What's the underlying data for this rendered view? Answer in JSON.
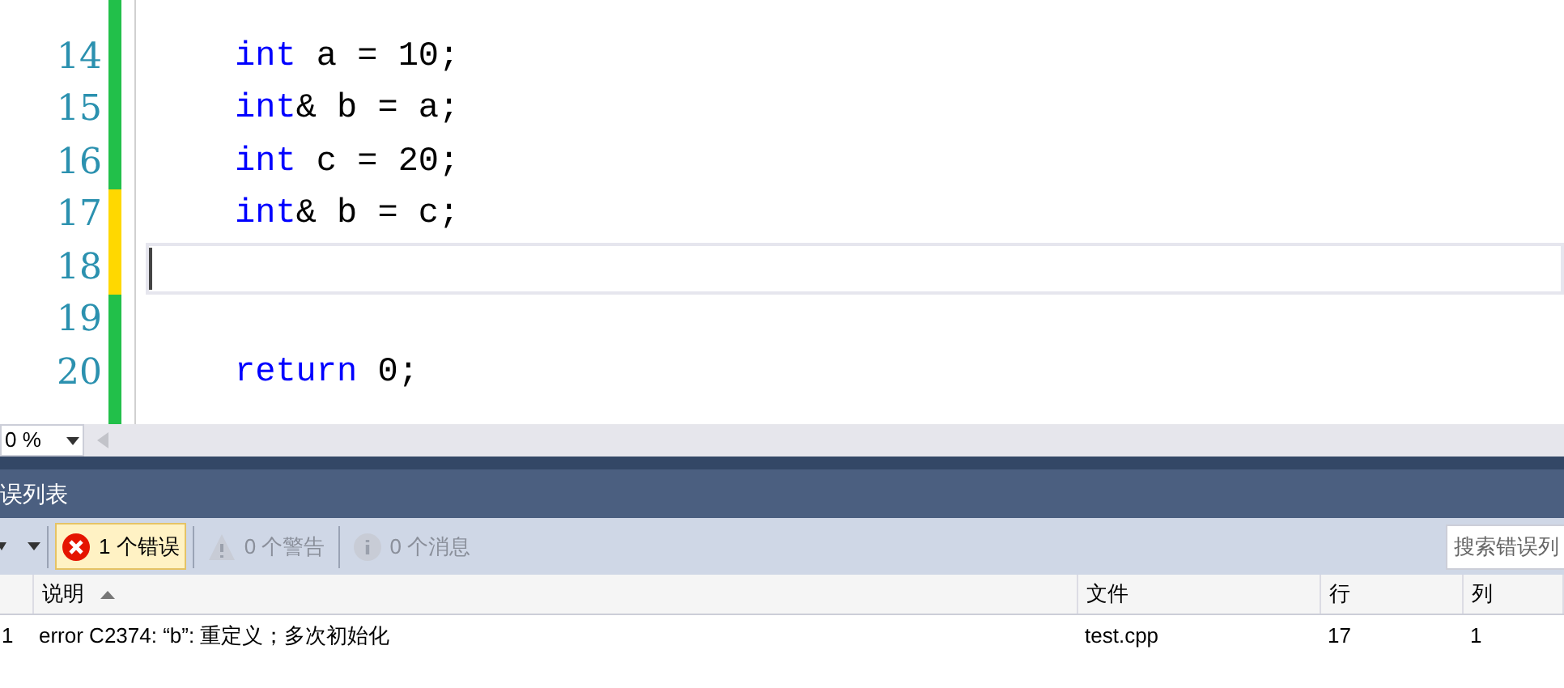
{
  "editor": {
    "lines": [
      {
        "color": "#22c04a"
      },
      {
        "number": "14",
        "color": "#22c04a",
        "tokens": [
          {
            "kind": "keyword",
            "text": "int"
          },
          {
            "kind": "plain",
            "text": " a = 10;"
          }
        ]
      },
      {
        "number": "15",
        "color": "#22c04a",
        "tokens": [
          {
            "kind": "keyword",
            "text": "int"
          },
          {
            "kind": "plain",
            "text": "& b = a;"
          }
        ]
      },
      {
        "number": "16",
        "color": "#22c04a",
        "tokens": [
          {
            "kind": "keyword",
            "text": "int"
          },
          {
            "kind": "plain",
            "text": " c = 20;"
          }
        ]
      },
      {
        "number": "17",
        "color": "#ffd800",
        "tokens": [
          {
            "kind": "keyword",
            "text": "int"
          },
          {
            "kind": "plain",
            "text": "& b = c;"
          }
        ]
      },
      {
        "number": "18",
        "color": "#ffd800",
        "current": true
      },
      {
        "number": "19",
        "color": "#22c04a"
      },
      {
        "number": "20",
        "color": "#22c04a",
        "tokens": [
          {
            "kind": "keyword",
            "text": "return"
          },
          {
            "kind": "plain",
            "text": " 0;"
          }
        ]
      },
      {
        "color": "#22c04a"
      }
    ],
    "zoom": "0 %"
  },
  "error_list": {
    "title": "误列表",
    "filters": [
      {
        "kind": "error",
        "label": "1 个错误",
        "selected": true
      },
      {
        "kind": "warning",
        "label": "0 个警告",
        "selected": false
      },
      {
        "kind": "message",
        "label": "0 个消息",
        "selected": false
      }
    ],
    "search": {
      "placeholder": "搜索错误列"
    },
    "columns": [
      "说明",
      "文件",
      "行",
      "列"
    ],
    "rows": [
      {
        "index": "1",
        "description": "error C2374: “b”: 重定义；多次初始化",
        "file": "test.cpp",
        "line": "17",
        "column": "1"
      }
    ]
  }
}
